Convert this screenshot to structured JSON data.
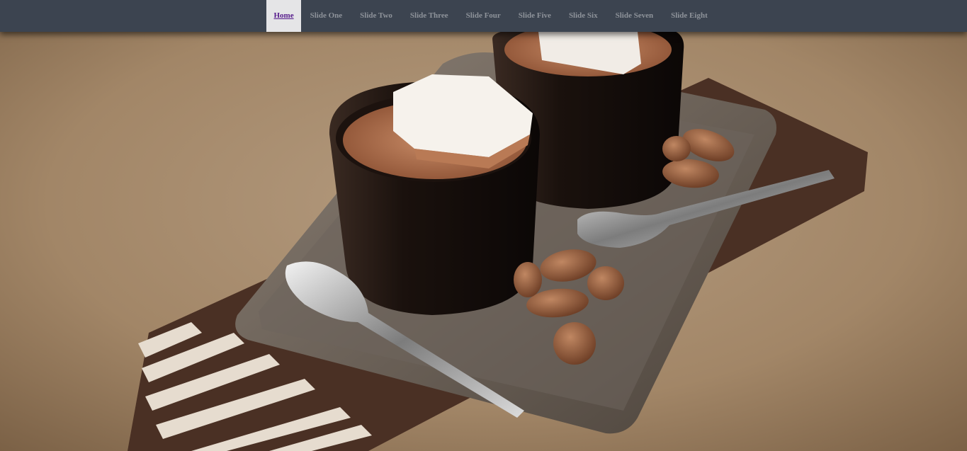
{
  "nav": {
    "items": [
      {
        "label": "Home",
        "active": true
      },
      {
        "label": "Slide One"
      },
      {
        "label": "Slide Two"
      },
      {
        "label": "Slide Three"
      },
      {
        "label": "Slide Four"
      },
      {
        "label": "Slide Five"
      },
      {
        "label": "Slide Six"
      },
      {
        "label": "Slide Seven"
      },
      {
        "label": "Slide Eight"
      }
    ]
  },
  "slide": {
    "image": "hot-chocolate-with-marshmallows-photo"
  },
  "colors": {
    "navbar_bg": "#3c4450",
    "nav_text": "#8e939a",
    "active_bg": "#e5e5e7",
    "active_text": "#551a8b",
    "background": "#a3886b"
  }
}
